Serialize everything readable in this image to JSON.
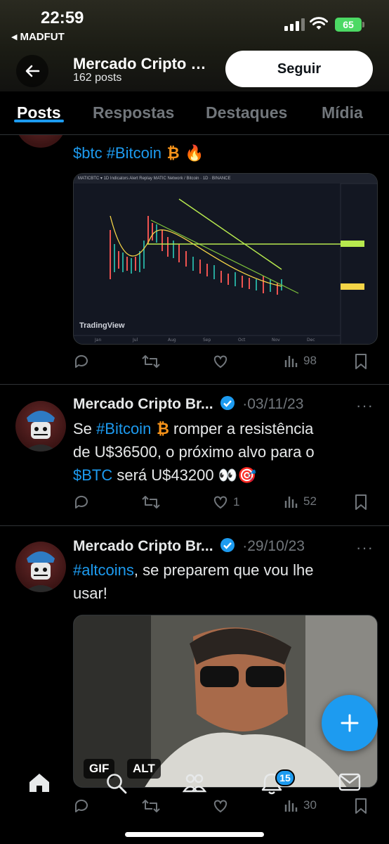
{
  "status_bar": {
    "time": "22:59",
    "back_app": "MADFUT",
    "battery": "65"
  },
  "profile": {
    "name": "Mercado Cripto Brasil",
    "post_count": "162 posts",
    "follow_label": "Seguir"
  },
  "tabs": [
    {
      "label": "Posts",
      "active": true
    },
    {
      "label": "Respostas",
      "active": false
    },
    {
      "label": "Destaques",
      "active": false
    },
    {
      "label": "Mídia",
      "active": false
    }
  ],
  "posts": [
    {
      "text_tail_prefix": "$btc #Bitcoin",
      "tail_emoji": "🔥",
      "chart_toolbar": "MATICBTC ▾   1D   Indicators   Alert   Replay      MATIC Network / Bitcoin · 1D · BINANCE",
      "chart_brand": "TradingView",
      "views": "98"
    },
    {
      "author": "Mercado Cripto Br...",
      "date": "·03/11/23",
      "line1_prefix": "Se ",
      "line1_tag": "#Bitcoin",
      "line1_rest": " romper a resistência",
      "line2": "de U$36500, o próximo alvo para o",
      "line3_tag": "$BTC",
      "line3_rest": " será U$43200 ",
      "likes": "1",
      "views": "52"
    },
    {
      "author": "Mercado Cripto Br...",
      "date": "·29/10/23",
      "line1_tag": "#altcoins",
      "line1_rest": ", se preparem que vou lhe",
      "line2": "usar!",
      "media_badges": [
        "GIF",
        "ALT"
      ],
      "views": "30"
    }
  ],
  "bottom_nav": {
    "notifications_count": "15"
  },
  "colors": {
    "accent": "#1d9bf0",
    "background": "#000000",
    "muted": "#71767b",
    "battery": "#4cd964"
  }
}
